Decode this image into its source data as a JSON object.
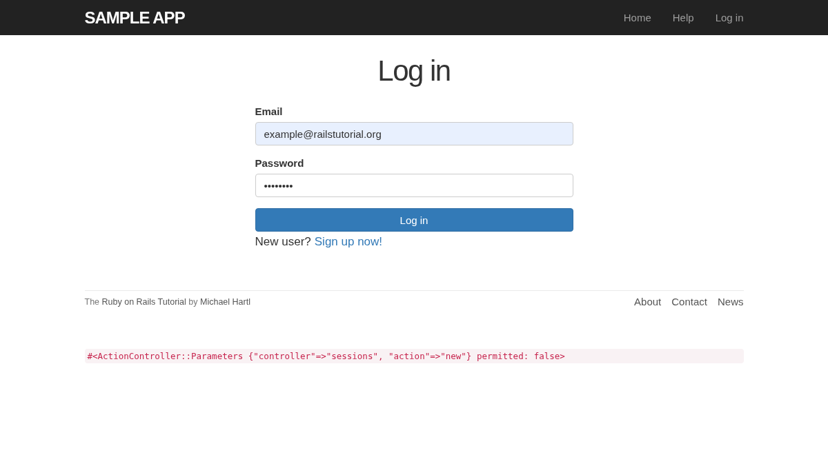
{
  "navbar": {
    "brand": "SAMPLE APP",
    "links": [
      "Home",
      "Help",
      "Log in"
    ]
  },
  "title": "Log in",
  "form": {
    "fields": [
      {
        "label": "Email",
        "value": "example@railstutorial.org",
        "autofilled": true
      },
      {
        "label": "Password",
        "value": "••••••••",
        "autofilled": false
      }
    ],
    "submit": "Log in",
    "signup_prompt": "New user?",
    "signup_link": "Sign up now!"
  },
  "footer": {
    "credit": [
      {
        "kind": "plain",
        "text": "The"
      },
      {
        "kind": "link",
        "text": "Ruby on Rails Tutorial"
      },
      {
        "kind": "plain",
        "text": "by"
      },
      {
        "kind": "link",
        "text": "Michael Hartl"
      }
    ],
    "links": [
      "About",
      "Contact",
      "News"
    ]
  },
  "debug": "#<ActionController::Parameters {\"controller\"=>\"sessions\", \"action\"=>\"new\"} permitted: false>"
}
